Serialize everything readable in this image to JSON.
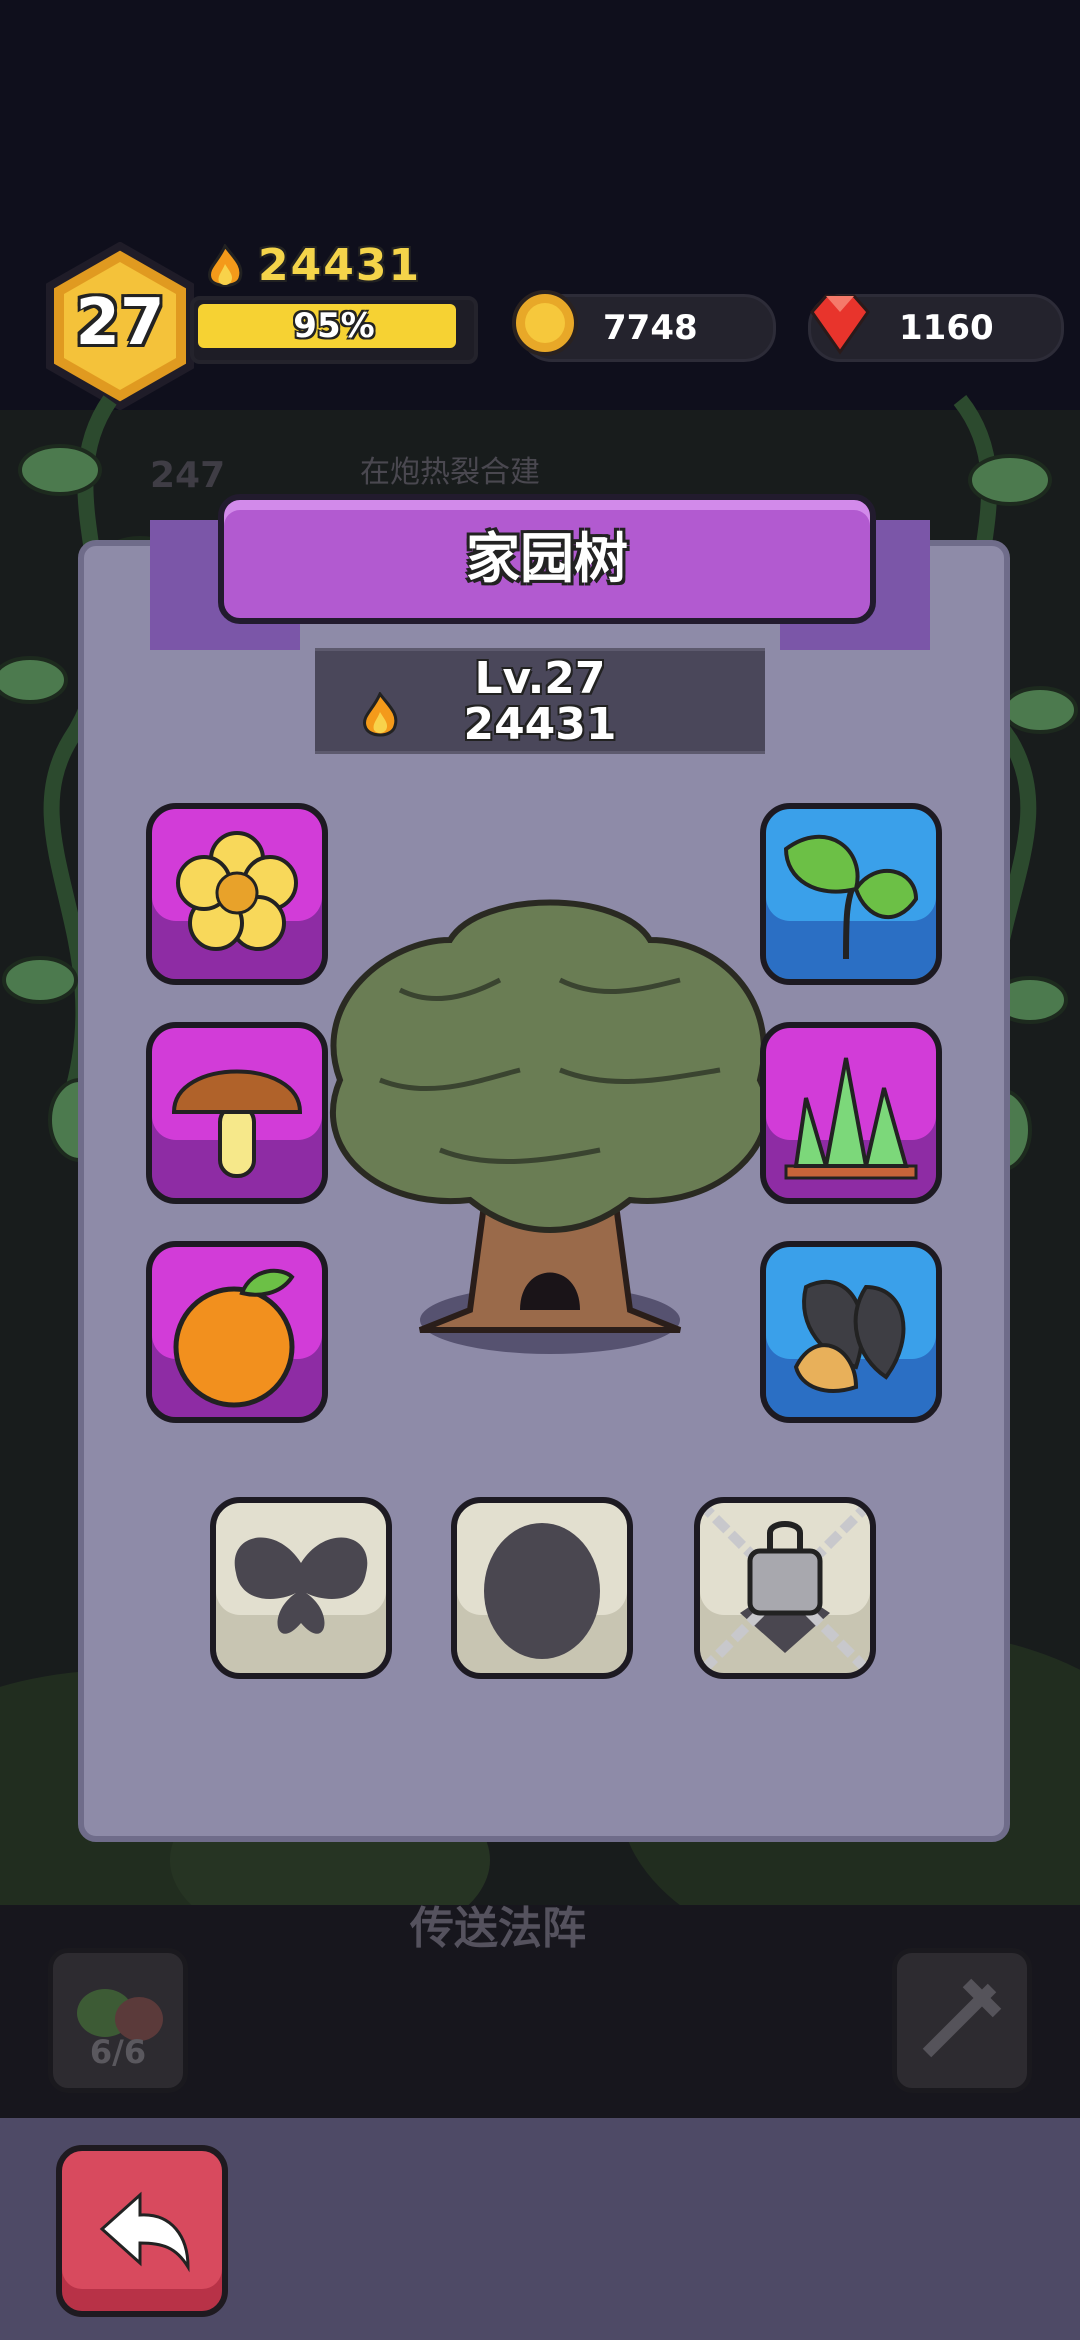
{
  "player": {
    "level": "27",
    "power": "24431",
    "progress_label": "95%",
    "progress_fraction": 0.95
  },
  "currency": {
    "coins": "7748",
    "gems": "1160"
  },
  "background": {
    "counter": "247",
    "status": "在炮热裂合建",
    "location_label": "传送法阵",
    "pet_count": "6/6"
  },
  "panel": {
    "title": "家园树",
    "level_label": "Lv.27",
    "power": "24431",
    "left_slots": [
      "flower-icon",
      "mushroom-icon",
      "orange-icon"
    ],
    "right_slots": [
      "leaves-icon",
      "grass-icon",
      "seeds-icon"
    ],
    "bottom_slots": [
      "butterfly-silhouette-icon",
      "egg-silhouette-icon",
      "locked-chain-icon"
    ]
  },
  "colors": {
    "accent_purple": "#b25ad0",
    "slot_pink": "#d23cd8",
    "slot_blue": "#3aa0ea",
    "xp_yellow": "#f6d233",
    "return_red": "#d84a5e"
  }
}
